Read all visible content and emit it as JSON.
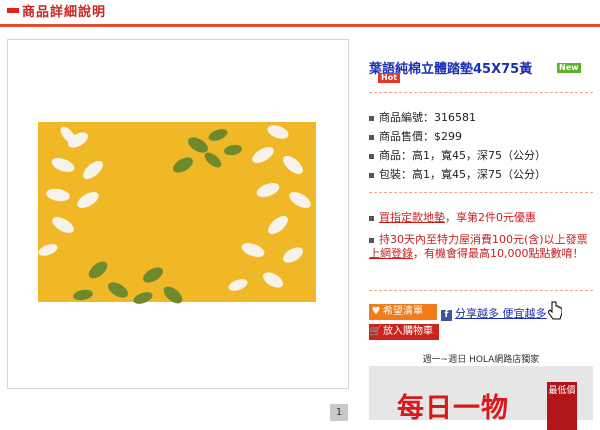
{
  "header": {
    "title": "商品詳細說明"
  },
  "gallery": {
    "page_number": "1"
  },
  "product": {
    "name": "葉語純棉立體踏墊45X75黃",
    "badge_new": "New",
    "badge_hot": "Hot",
    "specs": [
      {
        "text": "商品編號：316581"
      },
      {
        "text": "商品售價：$299"
      },
      {
        "text": "商品：高1，寬45，深75（公分）"
      },
      {
        "text": "包裝：高1，寬45，深75（公分）"
      }
    ],
    "promos": {
      "p1_link": "買指定款地墊",
      "p1_text": "，享第2件0元優惠",
      "p2_text_a": "持30天內至特力屋消費100元(含)以上發票",
      "p2_link": "上網登錄",
      "p2_text_b": "，有機會得最高10,000點點數唷！"
    }
  },
  "actions": {
    "wishlist_label": "希望清單",
    "cart_label": "放入購物車",
    "share_label": "分享越多 便宜越多"
  },
  "banner": {
    "top_text": "週一~週日 HOLA網路店獨家",
    "main_text": "每日一物",
    "tag_text": "最低價"
  },
  "colors": {
    "accent": "#e3211b",
    "link": "#1a2fb5",
    "mat_yellow": "#f0b726",
    "leaf_green": "#6e8a2d"
  }
}
